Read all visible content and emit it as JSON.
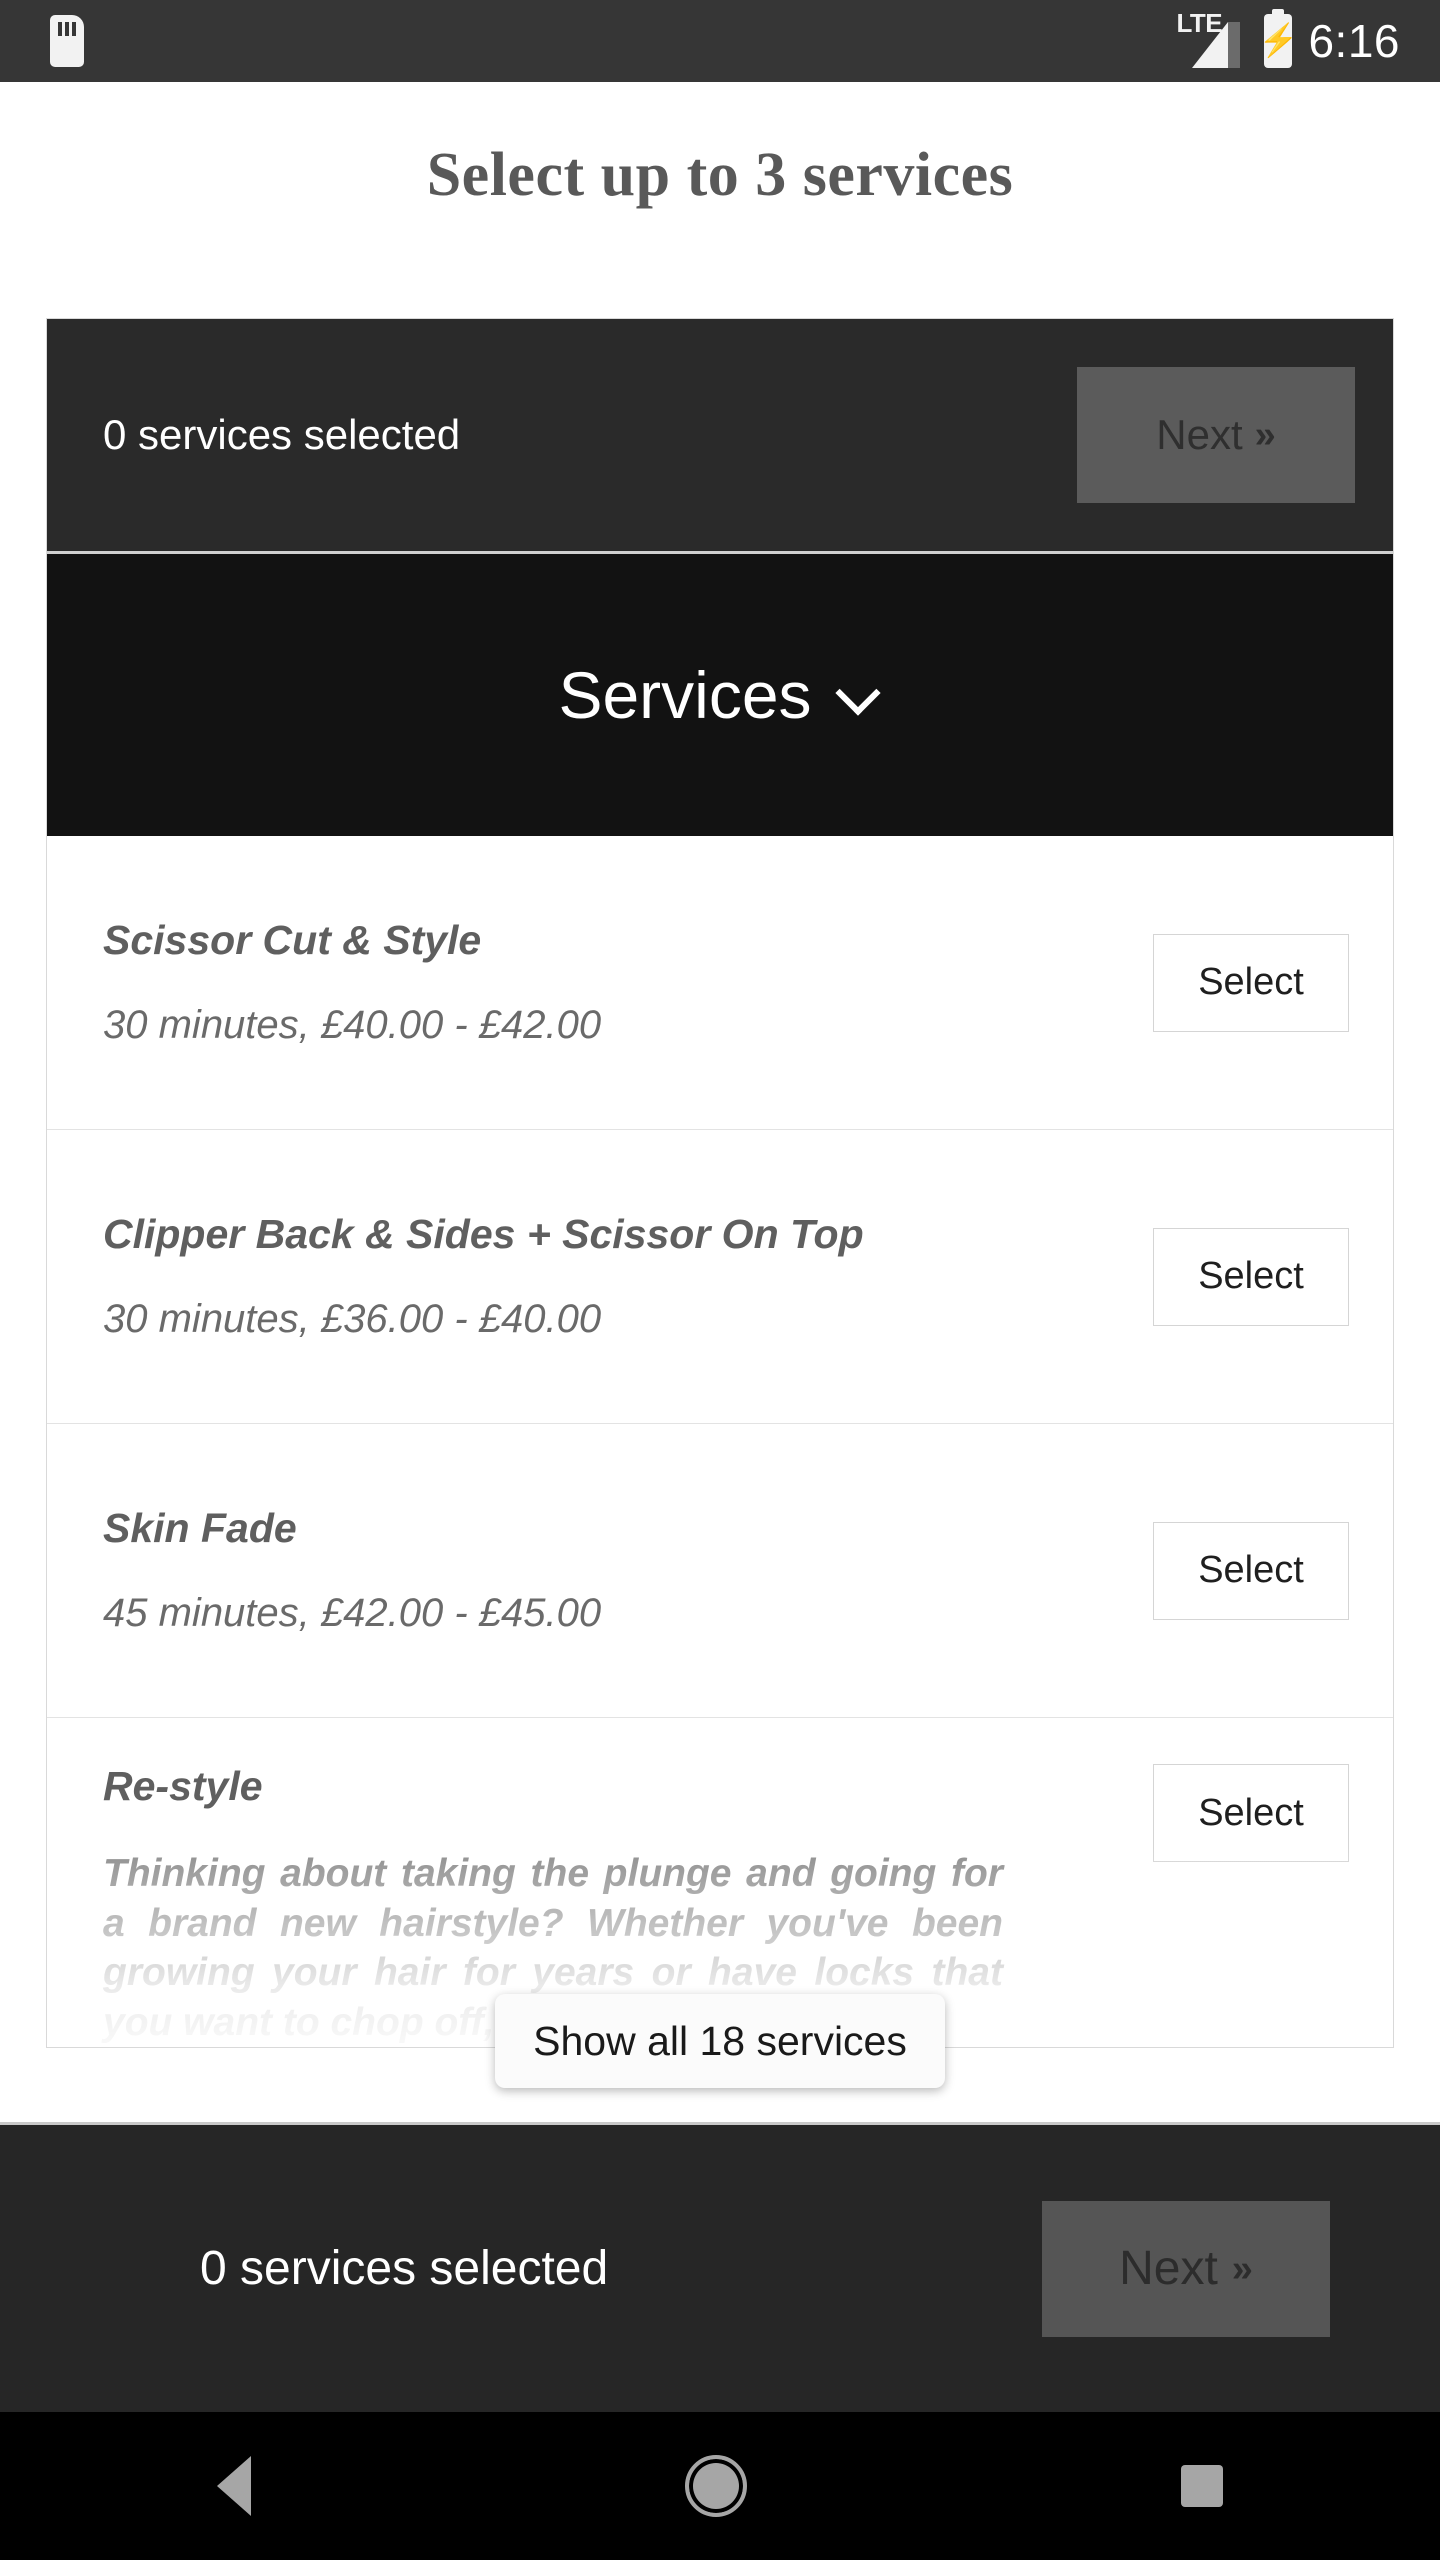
{
  "status_bar": {
    "sd_icon": "sd-card-icon",
    "network_label": "LTE",
    "signal_icon": "signal-bars-icon",
    "battery_icon": "battery-charging-icon",
    "time": "6:16"
  },
  "page_title": "Select up to 3 services",
  "selection_bar": {
    "summary": "0 services selected",
    "next_label": "Next",
    "next_chevron": "double-chevron-right-icon"
  },
  "category_header": {
    "title": "Services",
    "chevron": "chevron-down-icon"
  },
  "services": [
    {
      "name": "Scissor Cut & Style",
      "meta": "30 minutes, £40.00 - £42.00",
      "action": "Select"
    },
    {
      "name": "Clipper Back & Sides + Scissor On Top",
      "meta": "30 minutes, £36.00 - £40.00",
      "action": "Select"
    },
    {
      "name": "Skin Fade",
      "meta": "45 minutes, £42.00 - £45.00",
      "action": "Select"
    },
    {
      "name": "Re-style",
      "description": "Thinking about taking the plunge and going for a brand new hairstyle? Whether you've been growing your hair for years or have locks that you want to chop off, you'll get plenty of",
      "action": "Select"
    }
  ],
  "show_all_button": "Show all 18 services",
  "bottom_bar": {
    "summary": "0 services selected",
    "next_label": "Next",
    "next_chevron": "double-chevron-right-icon"
  },
  "nav_bar": {
    "back": "back-triangle-icon",
    "home": "home-circle-icon",
    "recents": "recents-square-icon"
  }
}
